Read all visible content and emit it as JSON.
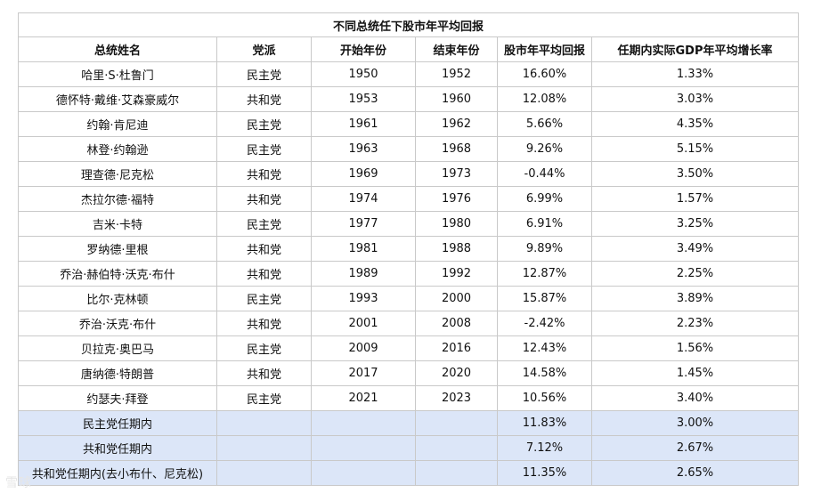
{
  "table": {
    "title": "不同总统任下股市年平均回报",
    "headers": [
      "总统姓名",
      "党派",
      "开始年份",
      "结束年份",
      "股市年平均回报",
      "任期内实际GDP年平均增长率"
    ],
    "rows": [
      [
        "哈里·S·杜鲁门",
        "民主党",
        "1950",
        "1952",
        "16.60%",
        "1.33%"
      ],
      [
        "德怀特·戴维·艾森豪威尔",
        "共和党",
        "1953",
        "1960",
        "12.08%",
        "3.03%"
      ],
      [
        "约翰·肯尼迪",
        "民主党",
        "1961",
        "1962",
        "5.66%",
        "4.35%"
      ],
      [
        "林登·约翰逊",
        "民主党",
        "1963",
        "1968",
        "9.26%",
        "5.15%"
      ],
      [
        "理查德·尼克松",
        "共和党",
        "1969",
        "1973",
        "-0.44%",
        "3.50%"
      ],
      [
        "杰拉尔德·福特",
        "共和党",
        "1974",
        "1976",
        "6.99%",
        "1.57%"
      ],
      [
        "吉米·卡特",
        "民主党",
        "1977",
        "1980",
        "6.91%",
        "3.25%"
      ],
      [
        "罗纳德·里根",
        "共和党",
        "1981",
        "1988",
        "9.89%",
        "3.49%"
      ],
      [
        "乔治·赫伯特·沃克·布什",
        "共和党",
        "1989",
        "1992",
        "12.87%",
        "2.25%"
      ],
      [
        "比尔·克林顿",
        "民主党",
        "1993",
        "2000",
        "15.87%",
        "3.89%"
      ],
      [
        "乔治·沃克·布什",
        "共和党",
        "2001",
        "2008",
        "-2.42%",
        "2.23%"
      ],
      [
        "贝拉克·奥巴马",
        "民主党",
        "2009",
        "2016",
        "12.43%",
        "1.56%"
      ],
      [
        "唐纳德·特朗普",
        "共和党",
        "2017",
        "2020",
        "14.58%",
        "1.45%"
      ],
      [
        "约瑟夫·拜登",
        "民主党",
        "2021",
        "2023",
        "10.56%",
        "3.40%"
      ]
    ],
    "summary": [
      [
        "民主党任期内",
        "",
        "",
        "",
        "11.83%",
        "3.00%"
      ],
      [
        "共和党任期内",
        "",
        "",
        "",
        "7.12%",
        "2.67%"
      ],
      [
        "共和党任期内(去小布什、尼克松)",
        "",
        "",
        "",
        "11.35%",
        "2.65%"
      ]
    ]
  },
  "watermark": "雪球"
}
